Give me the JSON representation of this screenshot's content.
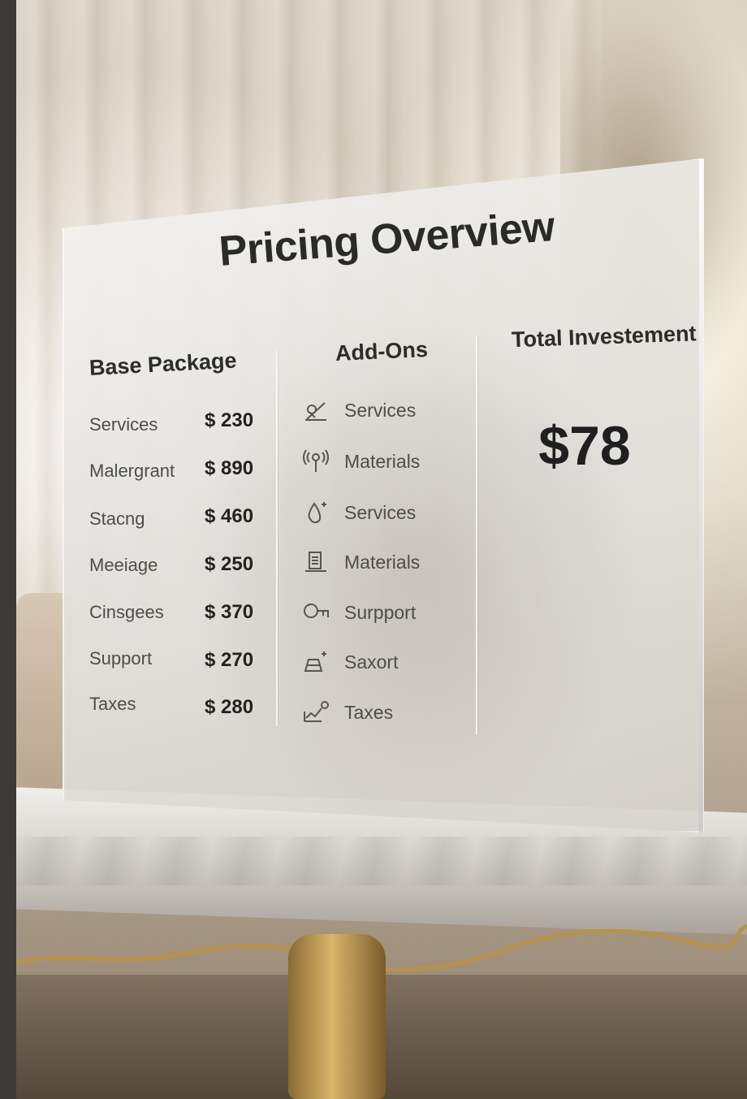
{
  "title": "Pricing Overview",
  "base_package": {
    "heading": "Base Package",
    "items": [
      {
        "label": "Services",
        "price": "$ 230"
      },
      {
        "label": "Malergrant",
        "price": "$ 890"
      },
      {
        "label": "Stacng",
        "price": "$ 460"
      },
      {
        "label": "Meeiage",
        "price": "$ 250"
      },
      {
        "label": "Cinsgees",
        "price": "$ 370"
      },
      {
        "label": "Support",
        "price": "$ 270"
      },
      {
        "label": "Taxes",
        "price": "$ 280"
      }
    ]
  },
  "addons": {
    "heading": "Add-Ons",
    "items": [
      {
        "label": "Services",
        "icon": "pen-icon"
      },
      {
        "label": "Materials",
        "icon": "signal-icon"
      },
      {
        "label": "Services",
        "icon": "drop-icon"
      },
      {
        "label": "Materials",
        "icon": "document-icon"
      },
      {
        "label": "Surpport",
        "icon": "key-icon"
      },
      {
        "label": "Saxort",
        "icon": "flask-icon"
      },
      {
        "label": "Taxes",
        "icon": "chart-icon"
      }
    ]
  },
  "total": {
    "heading": "Total Investement",
    "value": "$78"
  }
}
